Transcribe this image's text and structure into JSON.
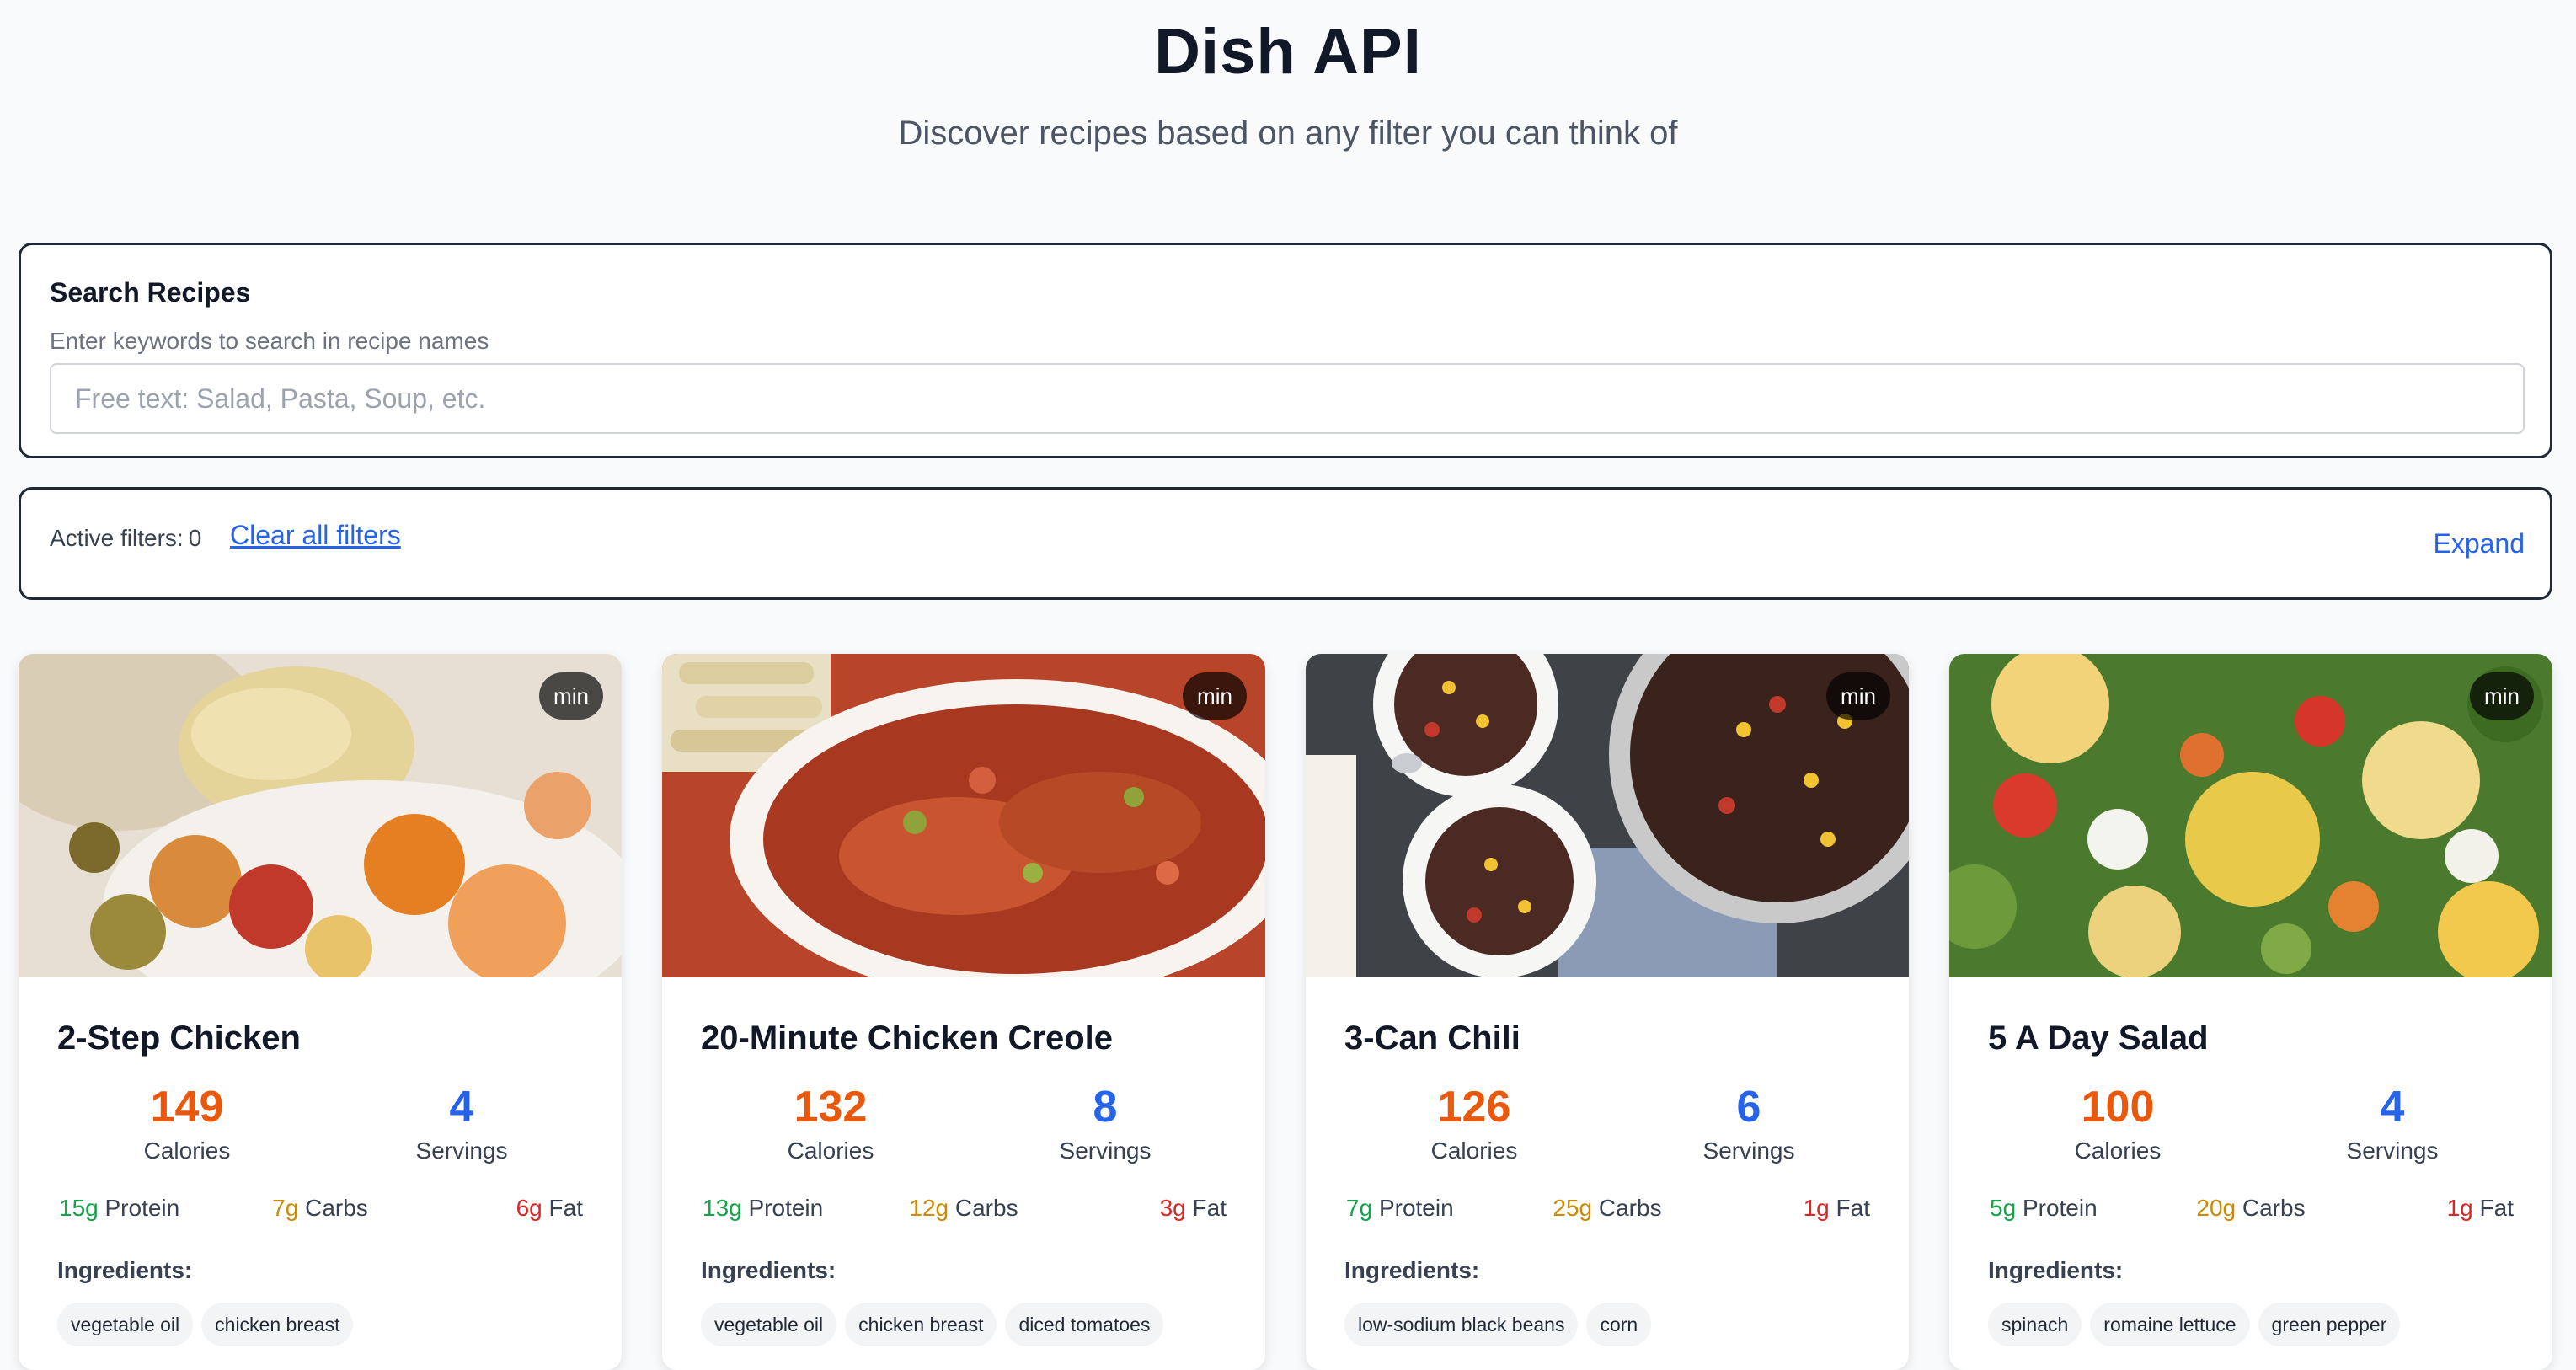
{
  "header": {
    "title": "Dish API",
    "subtitle": "Discover recipes based on any filter you can think of"
  },
  "search": {
    "label": "Search Recipes",
    "help": "Enter keywords to search in recipe names",
    "placeholder": "Free text: Salad, Pasta, Soup, etc.",
    "value": ""
  },
  "filters": {
    "active_label": "Active filters:",
    "active_count": "0",
    "clear_label": "Clear all filters",
    "expand_label": "Expand"
  },
  "recipes": [
    {
      "name": "2-Step Chicken",
      "time_badge": "min",
      "calories": "149",
      "calories_label": "Calories",
      "servings": "4",
      "servings_label": "Servings",
      "protein": "15g",
      "protein_label": "Protein",
      "carbs": "7g",
      "carbs_label": "Carbs",
      "fat": "6g",
      "fat_label": "Fat",
      "ingredients_label": "Ingredients:",
      "ingredients": [
        "vegetable oil",
        "chicken breast"
      ]
    },
    {
      "name": "20-Minute Chicken Creole",
      "time_badge": "min",
      "calories": "132",
      "calories_label": "Calories",
      "servings": "8",
      "servings_label": "Servings",
      "protein": "13g",
      "protein_label": "Protein",
      "carbs": "12g",
      "carbs_label": "Carbs",
      "fat": "3g",
      "fat_label": "Fat",
      "ingredients_label": "Ingredients:",
      "ingredients": [
        "vegetable oil",
        "chicken breast",
        "diced tomatoes"
      ]
    },
    {
      "name": "3-Can Chili",
      "time_badge": "min",
      "calories": "126",
      "calories_label": "Calories",
      "servings": "6",
      "servings_label": "Servings",
      "protein": "7g",
      "protein_label": "Protein",
      "carbs": "25g",
      "carbs_label": "Carbs",
      "fat": "1g",
      "fat_label": "Fat",
      "ingredients_label": "Ingredients:",
      "ingredients": [
        "low-sodium black beans",
        "corn"
      ]
    },
    {
      "name": "5 A Day Salad",
      "time_badge": "min",
      "calories": "100",
      "calories_label": "Calories",
      "servings": "4",
      "servings_label": "Servings",
      "protein": "5g",
      "protein_label": "Protein",
      "carbs": "20g",
      "carbs_label": "Carbs",
      "fat": "1g",
      "fat_label": "Fat",
      "ingredients_label": "Ingredients:",
      "ingredients": [
        "spinach",
        "romaine lettuce",
        "green pepper"
      ]
    }
  ],
  "colors": {
    "calories": "#ea580c",
    "servings": "#2563eb",
    "protein": "#16a34a",
    "carbs": "#ca8a04",
    "fat": "#dc2626",
    "link": "#2563eb"
  }
}
